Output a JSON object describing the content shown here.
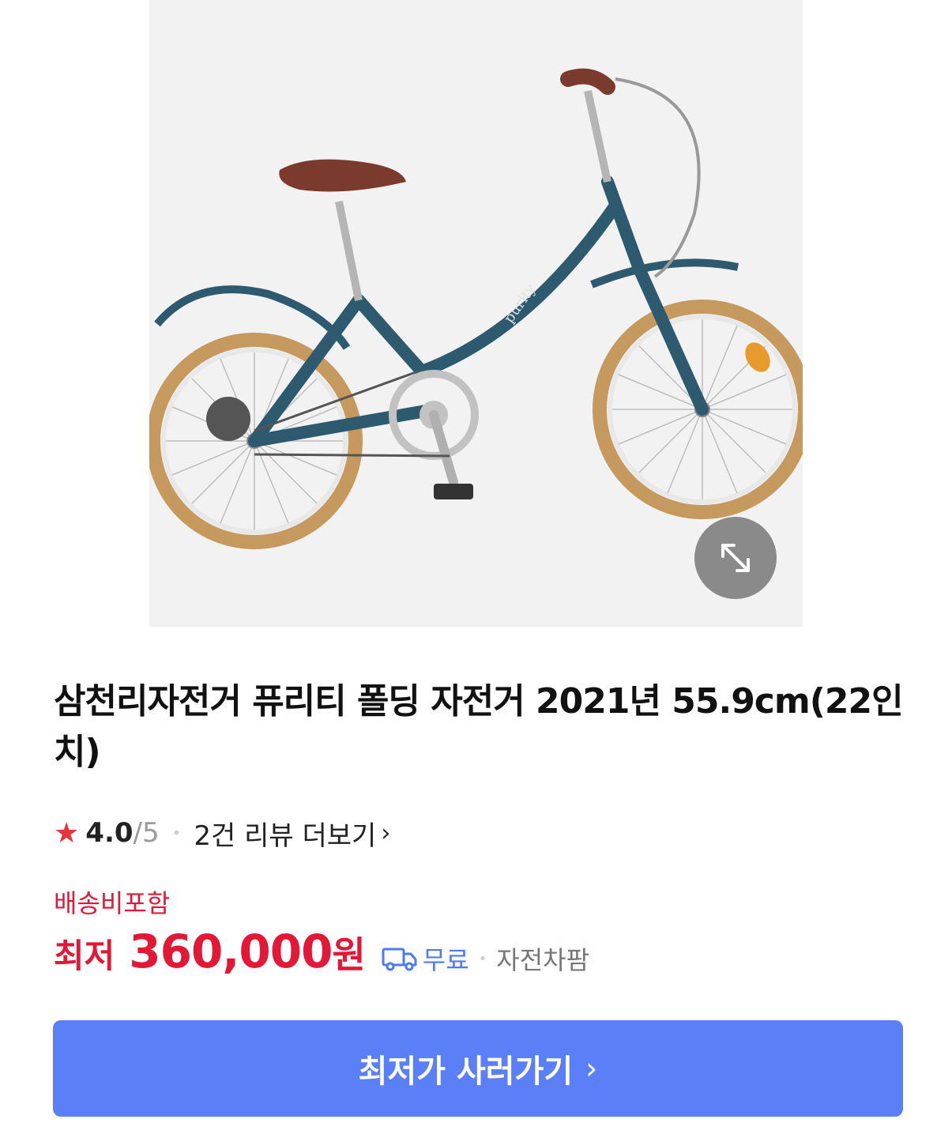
{
  "product": {
    "title": "삼천리자전거 퓨리티 폴딩 자전거 2021년 55.9cm(22인치)",
    "image_icon": "bicycle-illustration",
    "expand_icon": "expand-arrows-icon"
  },
  "rating": {
    "star_icon": "★",
    "value": "4.0",
    "max": "/5",
    "separator": "•",
    "review_link": "2건 리뷰 더보기",
    "chevron": "›"
  },
  "pricing": {
    "shipping_note": "배송비포함",
    "prefix": "최저",
    "amount": "360,000",
    "unit": "원",
    "delivery_label": "무료",
    "separator": "•",
    "seller": "자전차팜"
  },
  "cta": {
    "label": "최저가 사러가기",
    "chevron": "›"
  },
  "colors": {
    "price_red": "#e31837",
    "button_blue": "#5b7ff7",
    "delivery_blue": "#4c7bf3",
    "frame_teal": "#2d5a6e",
    "tire_tan": "#c69a5e"
  }
}
